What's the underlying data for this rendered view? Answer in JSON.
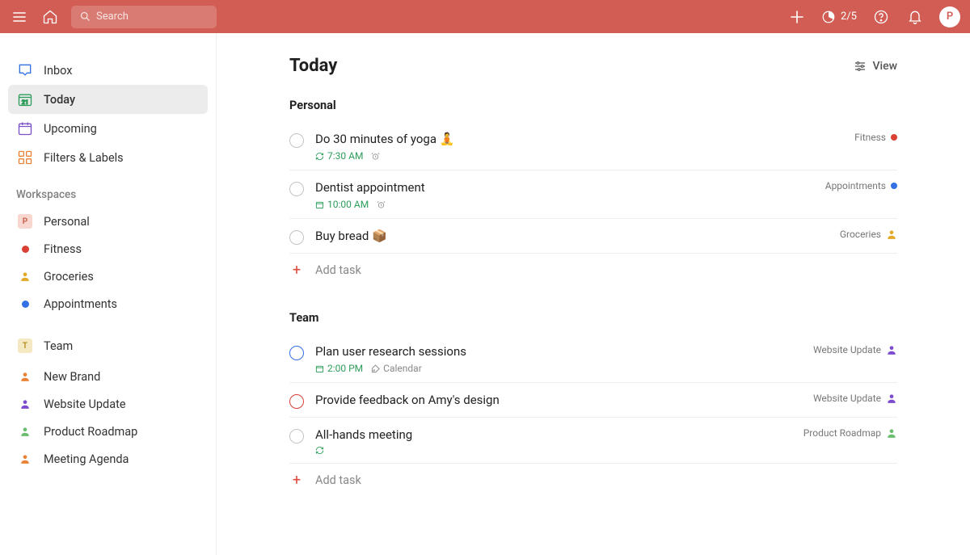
{
  "colors": {
    "brand": "#d15d55",
    "addPlus": "#dc4c3e",
    "green": "#2d9d5b",
    "blue": "#3270e4",
    "red": "#db4035",
    "gold": "#e3a828",
    "purple": "#7d4bcd",
    "orange": "#e98236",
    "lightgreen": "#6bbd6e"
  },
  "header": {
    "search_placeholder": "Search",
    "usage": "2/5",
    "avatar_initial": "P"
  },
  "sidebar": {
    "nav": [
      {
        "label": "Inbox",
        "icon": "inbox"
      },
      {
        "label": "Today",
        "icon": "today",
        "active": true
      },
      {
        "label": "Upcoming",
        "icon": "upcoming"
      },
      {
        "label": "Filters & Labels",
        "icon": "grid"
      }
    ],
    "section_title": "Workspaces",
    "workspaces": [
      {
        "label": "Personal",
        "icon_type": "badge",
        "badge_text": "P",
        "badge_bg": "#f7d7cf",
        "badge_fg": "#c65c48"
      },
      {
        "label": "Fitness",
        "icon_type": "dot",
        "dot_color": "#db4035"
      },
      {
        "label": "Groceries",
        "icon_type": "person",
        "person_color": "#e3a828"
      },
      {
        "label": "Appointments",
        "icon_type": "dot",
        "dot_color": "#3270e4"
      },
      {
        "label": "Team",
        "icon_type": "badge",
        "badge_text": "T",
        "badge_bg": "#f5e9c3",
        "badge_fg": "#b68e1f"
      },
      {
        "label": "New Brand",
        "icon_type": "person",
        "person_color": "#e98236"
      },
      {
        "label": "Website Update",
        "icon_type": "person",
        "person_color": "#7d4bcd"
      },
      {
        "label": "Product Roadmap",
        "icon_type": "person",
        "person_color": "#6bbd6e"
      },
      {
        "label": "Meeting Agenda",
        "icon_type": "person",
        "person_color": "#e98236"
      }
    ]
  },
  "main": {
    "title": "Today",
    "view_label": "View",
    "sections": [
      {
        "title": "Personal",
        "add_task_label": "Add task",
        "tasks": [
          {
            "title": "Do 30 minutes of yoga",
            "emoji": "🧘",
            "check_color": "#c4c4c4",
            "meta": [
              {
                "type": "recurring",
                "text": "7:30 AM",
                "color": "#2d9d5b"
              },
              {
                "type": "alarm"
              }
            ],
            "project": {
              "name": "Fitness",
              "icon_type": "dot",
              "icon_color": "#db4035"
            }
          },
          {
            "title": "Dentist appointment",
            "check_color": "#c4c4c4",
            "meta": [
              {
                "type": "calendar",
                "text": "10:00 AM",
                "color": "#2d9d5b"
              },
              {
                "type": "alarm"
              }
            ],
            "project": {
              "name": "Appointments",
              "icon_type": "dot",
              "icon_color": "#3270e4"
            }
          },
          {
            "title": "Buy bread",
            "emoji": "📦",
            "check_color": "#c4c4c4",
            "meta": [],
            "project": {
              "name": "Groceries",
              "icon_type": "person",
              "icon_color": "#e3a828"
            }
          }
        ]
      },
      {
        "title": "Team",
        "add_task_label": "Add task",
        "tasks": [
          {
            "title": "Plan user research sessions",
            "check_color": "#3270e4",
            "meta": [
              {
                "type": "calendar",
                "text": "2:00 PM",
                "color": "#2d9d5b"
              },
              {
                "type": "tag",
                "text": "Calendar",
                "color": "#888"
              }
            ],
            "project": {
              "name": "Website Update",
              "icon_type": "person",
              "icon_color": "#7d4bcd"
            }
          },
          {
            "title": "Provide feedback on Amy's design",
            "check_color": "#db4035",
            "meta": [],
            "project": {
              "name": "Website Update",
              "icon_type": "person",
              "icon_color": "#7d4bcd"
            }
          },
          {
            "title": "All-hands meeting",
            "check_color": "#c4c4c4",
            "meta": [
              {
                "type": "recurring-bare",
                "color": "#2d9d5b"
              }
            ],
            "project": {
              "name": "Product Roadmap",
              "icon_type": "person",
              "icon_color": "#6bbd6e"
            }
          }
        ]
      }
    ]
  }
}
